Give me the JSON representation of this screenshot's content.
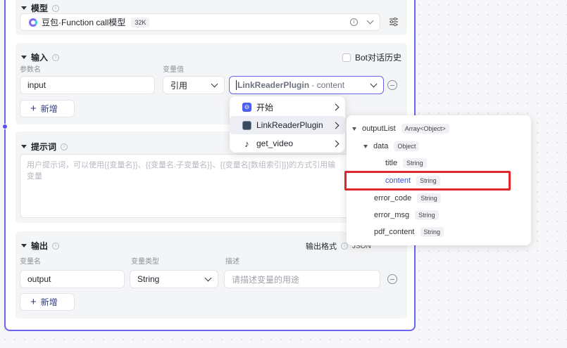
{
  "model_section": {
    "title": "模型",
    "model_name": "豆包·Function call模型",
    "context_badge": "32K"
  },
  "input_section": {
    "title": "输入",
    "bot_history_label": "Bot对话历史",
    "col_param_name": "参数名",
    "col_var_value": "变量值",
    "param_name_value": "input",
    "ref_type_value": "引用",
    "ref_value_plugin": "LinkReaderPlugin",
    "ref_value_sep": " - ",
    "ref_value_field": "content",
    "add_label": "新增"
  },
  "source_menu": {
    "items": [
      {
        "label": "开始"
      },
      {
        "label": "LinkReaderPlugin"
      },
      {
        "label": "get_video"
      }
    ]
  },
  "output_tree": {
    "root": {
      "name": "outputList",
      "type": "Array<Object>"
    },
    "data": {
      "name": "data",
      "type": "Object"
    },
    "title": {
      "name": "title",
      "type": "String"
    },
    "content": {
      "name": "content",
      "type": "String"
    },
    "error_code": {
      "name": "error_code",
      "type": "String"
    },
    "error_msg": {
      "name": "error_msg",
      "type": "String"
    },
    "pdf_content": {
      "name": "pdf_content",
      "type": "String"
    }
  },
  "prompt_section": {
    "title": "提示词",
    "placeholder_line1": "用户提示词，可以使用{{变量名}}、{{变量名.子变量名}}、{{变量名[数组索引]}}的方式引用输",
    "placeholder_line2": "变量"
  },
  "output_section": {
    "title": "输出",
    "format_label": "输出格式",
    "format_value": "JSON",
    "col_var_name": "变量名",
    "col_var_type": "变量类型",
    "col_desc": "描述",
    "var_name_value": "output",
    "var_type_value": "String",
    "desc_placeholder": "请描述变量的用途",
    "add_label": "新增"
  },
  "colors": {
    "node_border": "#6b64ef",
    "highlight_box": "#e0262b",
    "selected_text": "#3b4fe0"
  }
}
